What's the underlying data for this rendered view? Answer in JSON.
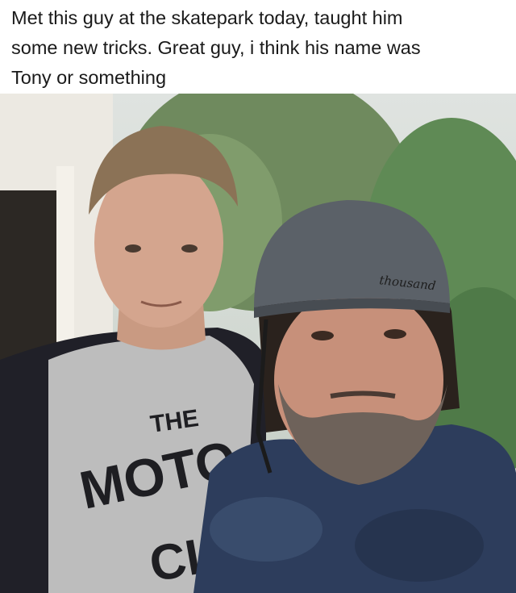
{
  "post": {
    "caption_line1": "Met this guy at the skatepark today, taught him",
    "caption_line2": "some new tricks. Great guy, i think his name was",
    "caption_line3": "Tony or something"
  },
  "photo": {
    "shirt_text_line1": "THE",
    "shirt_text_line2": "MOTO",
    "shirt_text_line3": "CI",
    "helmet_brand": "thousand"
  },
  "colors": {
    "shirt_body": "#bdbdbd",
    "shirt_sleeve": "#202028",
    "helmet": "#5b6168",
    "tee_right": "#2d3d5c"
  }
}
